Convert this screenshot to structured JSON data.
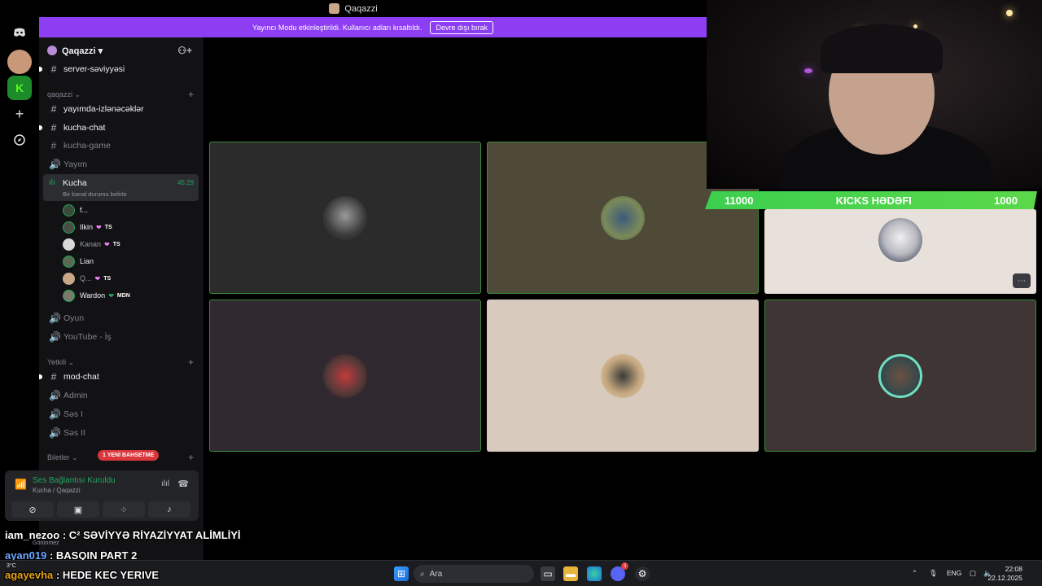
{
  "window": {
    "title": "Qaqazzi"
  },
  "banner": {
    "message": "Yayıncı Modu etkinleştirildi. Kullanıcı adları kısaltıldı.",
    "button": "Devre dışı bırak",
    "color": "#8d3ef2"
  },
  "server": {
    "name": "Qaqazzi ▾"
  },
  "channels_top": [
    {
      "label": "server-səviyyəsi",
      "type": "text"
    }
  ],
  "categories": {
    "qaqazzi": "qaqazzi ⌄",
    "yetkili": "Yetkili ⌄",
    "biletler": "Biletler ⌄"
  },
  "channels_qaqazzi": [
    {
      "label": "yayımda-izlənəcəklər",
      "type": "text"
    },
    {
      "label": "kucha-chat",
      "type": "text"
    },
    {
      "label": "kucha-game",
      "type": "text"
    },
    {
      "label": "Yayım",
      "type": "voice"
    }
  ],
  "active_voice": {
    "name": "Kucha",
    "status": "Bir kanal durumu belirle",
    "timer": "45:29"
  },
  "members": [
    {
      "name": "f...",
      "tag": ""
    },
    {
      "name": "Ilkin",
      "tag": "TS"
    },
    {
      "name": "Kanan",
      "tag": "TS"
    },
    {
      "name": "Lian",
      "tag": ""
    },
    {
      "name": "Q...",
      "tag": "TS"
    },
    {
      "name": "Wardon",
      "tag": "MDN"
    }
  ],
  "channels_after": [
    {
      "label": "Oyun",
      "type": "voice"
    },
    {
      "label": "YouTube - İş",
      "type": "voice"
    }
  ],
  "channels_yetkili": [
    {
      "label": "mod-chat",
      "type": "text"
    },
    {
      "label": "Admin",
      "type": "voice"
    },
    {
      "label": "Səs I",
      "type": "voice"
    },
    {
      "label": "Səs II",
      "type": "voice"
    }
  ],
  "new_badge": "1 YENİ BAHSETME",
  "voice_panel": {
    "status": "Ses Bağlantısı Kuruldu",
    "location": "Kucha / Qaqazzi",
    "user_status": "Görünmez"
  },
  "kicks_goal": {
    "left": "11000",
    "title": "KICKS HƏDƏFI",
    "right": "1000"
  },
  "chat": [
    {
      "user": "iam_nezoo",
      "message": ": C² SƏVİYYƏ RİYAZİYYAT ALİMLİYİ"
    },
    {
      "user": "ayan019",
      "message": ": BASQIN PART 2"
    },
    {
      "user": "agayevha",
      "message": ": HEDE KEC YERIVE"
    }
  ],
  "taskbar": {
    "search_placeholder": "Ara",
    "lang": "ENG",
    "time": "22:08",
    "date": "22.12.2025",
    "weather": "3°C",
    "discord_badge": "3"
  }
}
